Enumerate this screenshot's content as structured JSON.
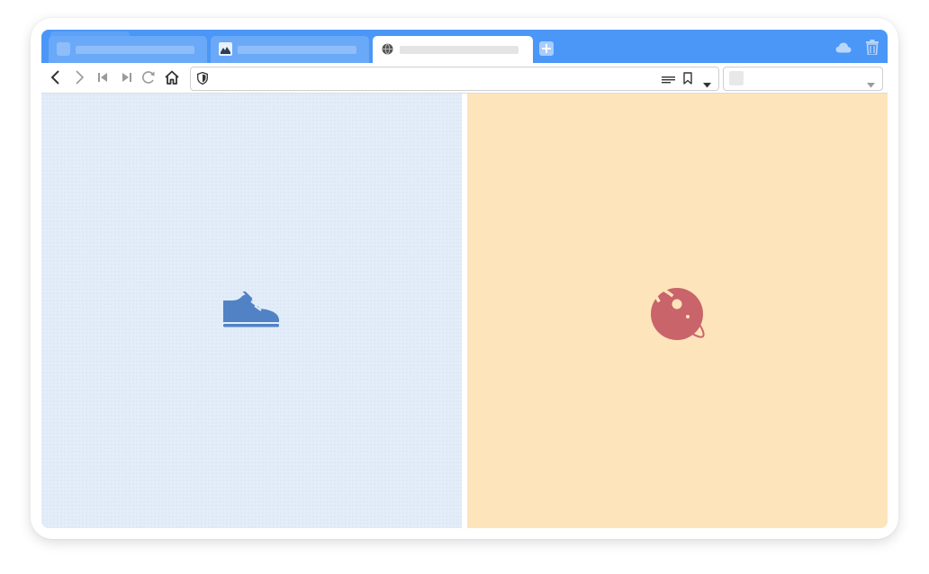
{
  "window": {
    "address_bar": {
      "value": ""
    },
    "search_bar": {
      "value": ""
    }
  },
  "tabs": [
    {
      "icon": "blank-favicon-icon",
      "state": "inactive",
      "stacked": true
    },
    {
      "icon": "image-favicon-icon",
      "state": "inactive",
      "stacked": false
    },
    {
      "icon": "globe-favicon-icon",
      "state": "active",
      "stacked": false
    }
  ],
  "toolbar": {
    "buttons": [
      "back-icon",
      "forward-icon",
      "rewind-icon",
      "fast-forward-icon",
      "reload-icon",
      "home-icon"
    ],
    "address_icons": [
      "shield-icon",
      "reader-view-icon",
      "bookmark-icon",
      "dropdown-icon"
    ]
  },
  "tile_panes": [
    {
      "icon": "sneaker-icon",
      "background": "#e3edf9",
      "icon_color": "#5182c6"
    },
    {
      "icon": "planet-icon",
      "background": "#fde4ba",
      "icon_color": "#c9646b"
    }
  ],
  "colors": {
    "tab_bar": "#4a97f7",
    "accent": "#4a97f7"
  }
}
